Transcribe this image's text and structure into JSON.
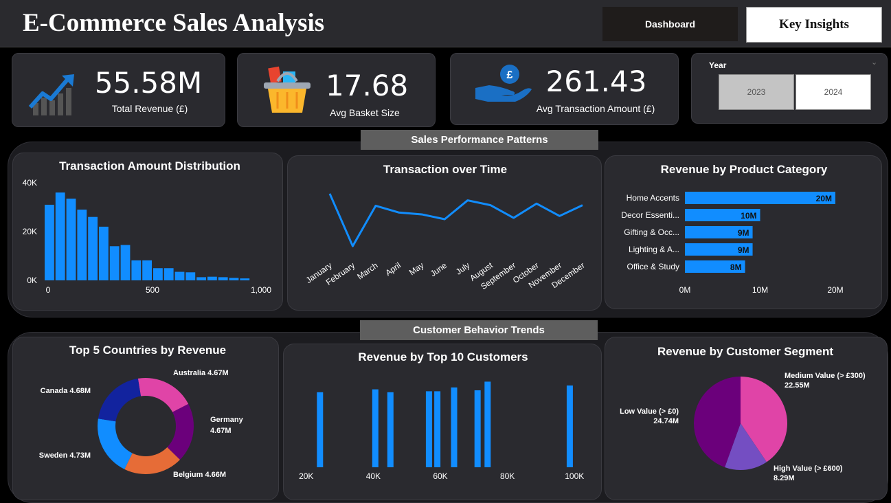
{
  "header": {
    "title": "E-Commerce Sales Analysis",
    "nav": {
      "dashboard": "Dashboard",
      "key_insights": "Key Insights"
    }
  },
  "kpis": [
    {
      "value": "55.58M",
      "label": "Total Revenue (£)",
      "icon": "growth-chart-icon"
    },
    {
      "value": "17.68",
      "label": "Avg Basket Size",
      "icon": "shopping-basket-icon"
    },
    {
      "value": "261.43",
      "label": "Avg Transaction Amount (£)",
      "icon": "hand-coin-icon"
    }
  ],
  "year_slicer": {
    "label": "Year",
    "options": [
      "2023",
      "2024"
    ],
    "selected": "2023"
  },
  "sections": {
    "sales": "Sales Performance Patterns",
    "customer": "Customer Behavior Trends"
  },
  "colors": {
    "accent": "#118dff",
    "pink": "#e044a7",
    "purple": "#6b007b",
    "orange": "#e66c37",
    "navy": "#12239e",
    "violet": "#744ec2"
  },
  "chart_data": [
    {
      "type": "bar",
      "title": "Transaction Amount Distribution",
      "x_ticks": [
        "0",
        "500",
        "1,000"
      ],
      "y_ticks": [
        "0K",
        "20K",
        "40K"
      ],
      "xlim": [
        0,
        1000
      ],
      "ylim": [
        0,
        40000
      ],
      "bin_width": 50,
      "bin_starts": [
        0,
        50,
        100,
        150,
        200,
        250,
        300,
        350,
        400,
        450,
        500,
        550,
        600,
        650,
        700,
        750,
        800,
        850,
        900,
        950
      ],
      "values": [
        31000,
        36000,
        33500,
        29000,
        26000,
        22000,
        14000,
        14500,
        8200,
        8200,
        5000,
        5000,
        3500,
        3300,
        1300,
        1500,
        1300,
        1000,
        800,
        0
      ]
    },
    {
      "type": "line",
      "title": "Transaction over Time",
      "categories": [
        "January",
        "February",
        "March",
        "April",
        "May",
        "June",
        "July",
        "August",
        "September",
        "October",
        "November",
        "December"
      ],
      "values": [
        31500,
        12000,
        27000,
        24500,
        23800,
        22000,
        29000,
        27200,
        22500,
        27800,
        23200,
        27200
      ],
      "ylim": [
        10000,
        34000
      ]
    },
    {
      "type": "bar",
      "orientation": "horizontal",
      "title": "Revenue by Product Category",
      "categories": [
        "Home Accents",
        "Decor Essenti...",
        "Gifting & Occ...",
        "Lighting & A...",
        "Office & Study"
      ],
      "values": [
        20,
        10,
        9,
        9,
        8
      ],
      "data_labels": [
        "20M",
        "10M",
        "9M",
        "9M",
        "8M"
      ],
      "x_ticks": [
        "0M",
        "10M",
        "20M"
      ],
      "xlim": [
        0,
        20
      ]
    },
    {
      "type": "pie",
      "donut": true,
      "title": "Top 5 Countries by Revenue",
      "slices": [
        {
          "label": "Australia",
          "value": 4.67,
          "display": "Australia 4.67M",
          "color": "#e044a7"
        },
        {
          "label": "Germany",
          "value": 4.67,
          "display": "Germany 4.67M",
          "color": "#6b007b"
        },
        {
          "label": "Belgium",
          "value": 4.66,
          "display": "Belgium 4.66M",
          "color": "#e66c37"
        },
        {
          "label": "Sweden",
          "value": 4.73,
          "display": "Sweden 4.73M",
          "color": "#118dff"
        },
        {
          "label": "Canada",
          "value": 4.68,
          "display": "Canada 4.68M",
          "color": "#12239e"
        }
      ]
    },
    {
      "type": "bar",
      "title": "Revenue by Top 10 Customers",
      "x_ticks": [
        "20K",
        "40K",
        "60K",
        "80K",
        "100K"
      ],
      "xlim": [
        18000,
        102000
      ],
      "ylim": [
        0,
        1
      ],
      "x": [
        24000,
        40500,
        45000,
        56500,
        59000,
        64000,
        71000,
        74000,
        98500
      ],
      "values": [
        0.78,
        0.81,
        0.78,
        0.79,
        0.79,
        0.83,
        0.8,
        0.89,
        0.85
      ]
    },
    {
      "type": "pie",
      "title": "Revenue by Customer Segment",
      "slices": [
        {
          "label": "Medium Value (> £300)",
          "value": 22.55,
          "display_value": "22.55M",
          "color": "#e044a7"
        },
        {
          "label": "High Value (> £600)",
          "value": 8.29,
          "display_value": "8.29M",
          "color": "#744ec2"
        },
        {
          "label": "Low Value (> £0)",
          "value": 24.74,
          "display_value": "24.74M",
          "color": "#6b007b"
        }
      ]
    }
  ]
}
